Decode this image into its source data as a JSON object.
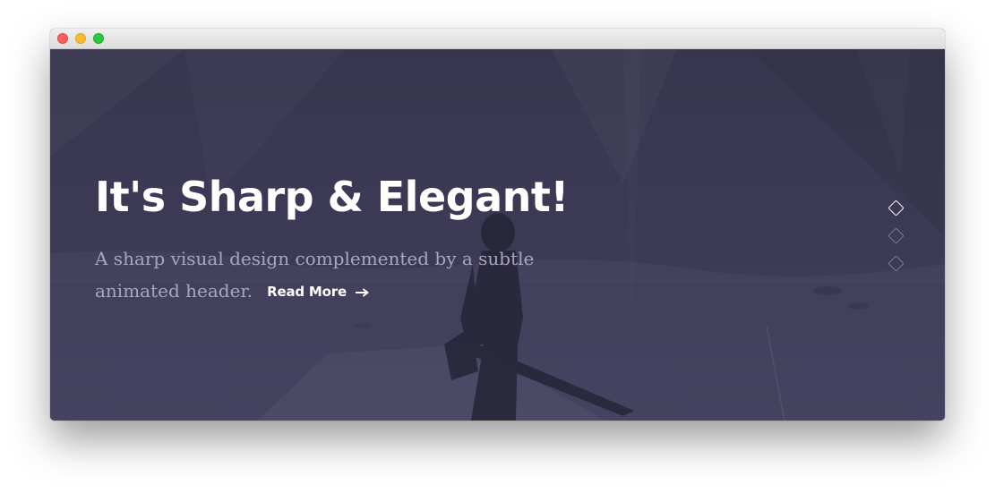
{
  "window": {
    "controls": [
      "close",
      "minimize",
      "zoom"
    ]
  },
  "hero": {
    "headline": "It's Sharp & Elegant!",
    "subtext": "A sharp visual design complemented by a subtle animated header.",
    "read_more": "Read More",
    "read_more_icon": "arrow-right-icon",
    "overlay_color": "#3a3850"
  },
  "slider": {
    "count": 3,
    "active_index": 0
  }
}
